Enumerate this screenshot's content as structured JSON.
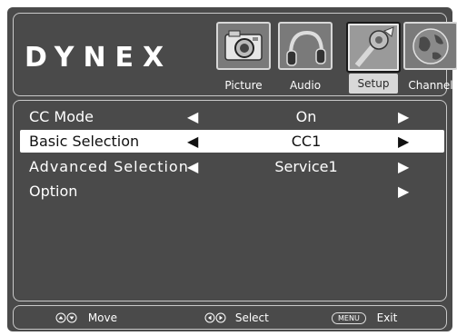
{
  "brand": "DYNEX",
  "tabs": [
    {
      "label": "Picture",
      "icon": "camera-icon",
      "selected": false
    },
    {
      "label": "Audio",
      "icon": "headphones-icon",
      "selected": false
    },
    {
      "label": "Setup",
      "icon": "tools-icon",
      "selected": true
    },
    {
      "label": "Channel",
      "icon": "globe-icon",
      "selected": false
    }
  ],
  "menu": {
    "rows": [
      {
        "name": "CC Mode",
        "left_arrow": "◀",
        "value": "On",
        "right_arrow": "▶",
        "selected": false
      },
      {
        "name": "Basic Selection",
        "left_arrow": "◀",
        "value": "CC1",
        "right_arrow": "▶",
        "selected": true
      },
      {
        "name": "Advanced Selection",
        "left_arrow": "◀",
        "value": "Service1",
        "right_arrow": "▶",
        "selected": false
      },
      {
        "name": "Option",
        "left_arrow": "",
        "value": "",
        "right_arrow": "▶",
        "selected": false
      }
    ]
  },
  "footer": {
    "move_label": "Move",
    "select_label": "Select",
    "menu_key": "MENU",
    "exit_label": "Exit"
  },
  "colors": {
    "background": "#4a4a4a",
    "panel_border": "#c9c9c9",
    "highlight": "#ffffff",
    "text": "#ffffff"
  }
}
